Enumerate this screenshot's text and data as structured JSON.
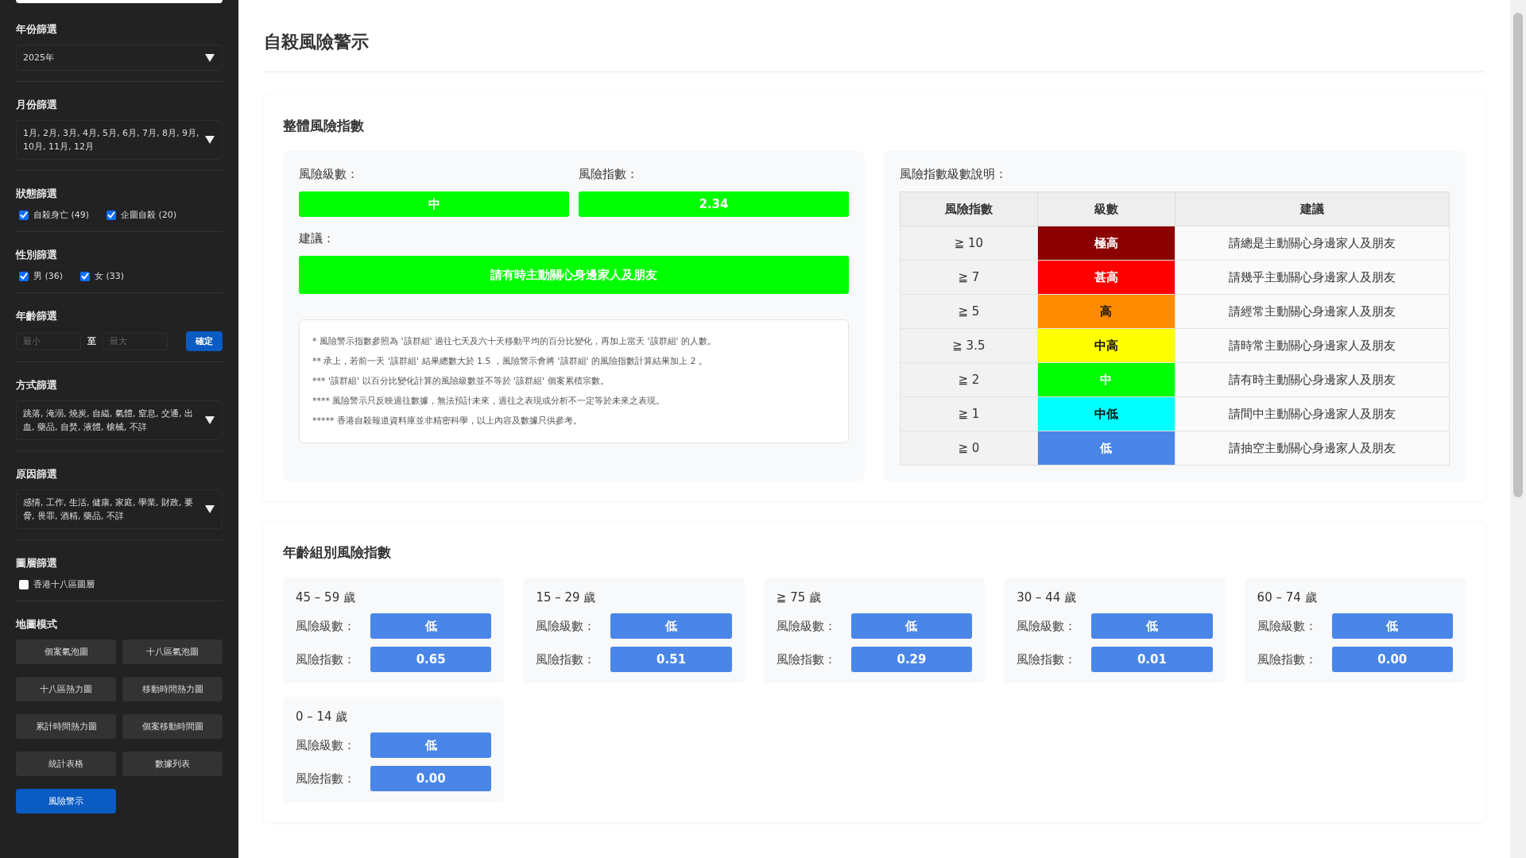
{
  "sidebar": {
    "sections": [
      {
        "kind": "select",
        "title": "年份篩選",
        "value": "2025年"
      },
      {
        "kind": "select",
        "title": "月份篩選",
        "value": "1月, 2月, 3月, 4月, 5月, 6月, 7月, 8月, 9月, 10月, 11月, 12月"
      },
      {
        "kind": "checkboxes",
        "title": "狀態篩選",
        "options": [
          {
            "label": "自殺身亡 (49)",
            "checked": true
          },
          {
            "label": "企圖自殺 (20)",
            "checked": true
          }
        ]
      },
      {
        "kind": "checkboxes",
        "title": "性別篩選",
        "options": [
          {
            "label": "男 (36)",
            "checked": true
          },
          {
            "label": "女 (33)",
            "checked": true
          }
        ]
      },
      {
        "kind": "range",
        "title": "年齡篩選",
        "min_placeholder": "最小",
        "separator": "至",
        "max_placeholder": "最大",
        "button": "確定"
      },
      {
        "kind": "select",
        "title": "方式篩選",
        "value": "跳落, 淹溺, 燒炭, 自縊, 氣體, 窒息, 交通, 出血, 藥品, 自焚, 液體, 槍械, 不詳"
      },
      {
        "kind": "select",
        "title": "原因篩選",
        "value": "感情, 工作, 生活, 健康, 家庭, 學業, 財政, 要脅, 畏罪, 酒精, 藥品, 不詳"
      },
      {
        "kind": "checkboxes",
        "title": "圖層篩選",
        "options": [
          {
            "label": "香港十八區圖層",
            "checked": false
          }
        ]
      },
      {
        "kind": "buttons",
        "title": "地圖模式",
        "buttons": [
          {
            "label": "個案氣泡圖",
            "selected": false
          },
          {
            "label": "十八區氣泡圖",
            "selected": false
          },
          {
            "label": "十八區熱力圖",
            "selected": false
          },
          {
            "label": "移動時間熱力圖",
            "selected": false
          },
          {
            "label": "累計時間熱力圖",
            "selected": false
          },
          {
            "label": "個案移動時間圖",
            "selected": false
          },
          {
            "label": "統計表格",
            "selected": false
          },
          {
            "label": "數據列表",
            "selected": false
          },
          {
            "label": "風險警示",
            "selected": true
          }
        ]
      }
    ]
  },
  "page_title": "自殺風險警示",
  "overall": {
    "heading": "整體風險指數",
    "level_label": "風險級數：",
    "level": "中",
    "index_label": "風險指數：",
    "index": "2.34",
    "advice_label": "建議：",
    "advice": "請有時主動關心身邊家人及朋友",
    "color": "#00ff00",
    "notes": [
      "* 風險警示指數參照為 '該群組' 過往七天及六十天移動平均的百分比變化，再加上當天 '該群組' 的人數。",
      "** 承上，若前一天 '該群組' 結果總數大於 1.5 ，風險警示會將 '該群組' 的風險指數計算結果加上 2 。",
      "*** '該群組' 以百分比變化計算的風險級數並不等於 '該群組' 個案累積宗數。",
      "**** 風險警示只反映過往數據，無法預計未來，過往之表現或分析不一定等於未來之表現。",
      "***** 香港自殺報道資料庫並非精密科學，以上內容及數據只供參考。"
    ]
  },
  "legend": {
    "title": "風險指數級數說明：",
    "columns": [
      "風險指數",
      "級數",
      "建議"
    ],
    "rows": [
      {
        "threshold": "≧ 10",
        "level": "極高",
        "advice": "請總是主動關心身邊家人及朋友",
        "color": "#8b0000"
      },
      {
        "threshold": "≧ 7",
        "level": "甚高",
        "advice": "請幾乎主動關心身邊家人及朋友",
        "color": "#ff0000"
      },
      {
        "threshold": "≧ 5",
        "level": "高",
        "advice": "請經常主動關心身邊家人及朋友",
        "color": "#ff8c00"
      },
      {
        "threshold": "≧ 3.5",
        "level": "中高",
        "advice": "請時常主動關心身邊家人及朋友",
        "color": "#ffff00"
      },
      {
        "threshold": "≧ 2",
        "level": "中",
        "advice": "請有時主動關心身邊家人及朋友",
        "color": "#00ff00"
      },
      {
        "threshold": "≧ 1",
        "level": "中低",
        "advice": "請間中主動關心身邊家人及朋友",
        "color": "#00ffff"
      },
      {
        "threshold": "≧ 0",
        "level": "低",
        "advice": "請抽空主動關心身邊家人及朋友",
        "color": "#4a86e8"
      }
    ]
  },
  "age_groups": {
    "heading": "年齡組別風險指數",
    "groups": [
      {
        "label": "45 – 59 歲",
        "level_label": "風險級數：",
        "level": "低",
        "index_label": "風險指數：",
        "index": "0.65",
        "color": "#4a86e8"
      },
      {
        "label": "15 – 29 歲",
        "level_label": "風險級數：",
        "level": "低",
        "index_label": "風險指數：",
        "index": "0.51",
        "color": "#4a86e8"
      },
      {
        "label": "≧ 75 歲",
        "level_label": "風險級數：",
        "level": "低",
        "index_label": "風險指數：",
        "index": "0.29",
        "color": "#4a86e8"
      },
      {
        "label": "30 – 44 歲",
        "level_label": "風險級數：",
        "level": "低",
        "index_label": "風險指數：",
        "index": "0.01",
        "color": "#4a86e8"
      },
      {
        "label": "60 – 74 歲",
        "level_label": "風險級數：",
        "level": "低",
        "index_label": "風險指數：",
        "index": "0.00",
        "color": "#4a86e8"
      },
      {
        "label": "0 – 14 歲",
        "level_label": "風險級數：",
        "level": "低",
        "index_label": "風險指數：",
        "index": "0.00",
        "color": "#4a86e8"
      }
    ]
  }
}
